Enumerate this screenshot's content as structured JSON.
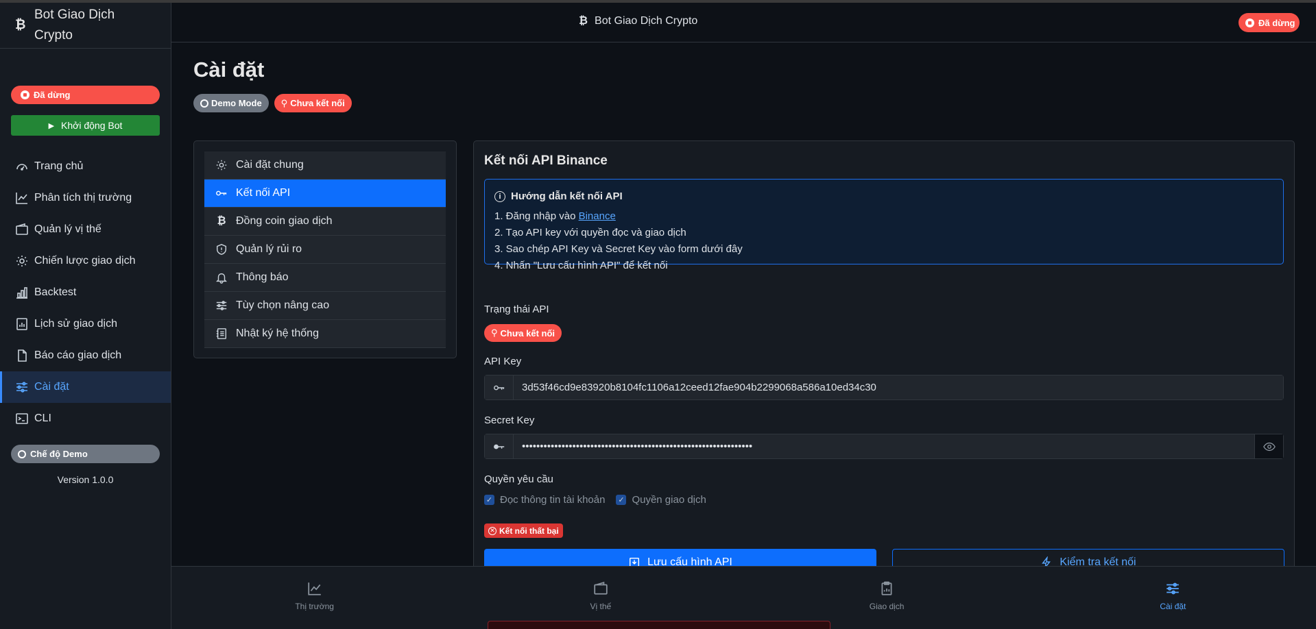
{
  "app": {
    "coin_symbol": "₿",
    "name": "Bot Giao Dịch Crypto"
  },
  "sidebar": {
    "status_label": "Đã dừng",
    "start_button": "Khởi động Bot",
    "items": [
      {
        "label": "Trang chủ",
        "icon": "dashboard-icon"
      },
      {
        "label": "Phân tích thị trường",
        "icon": "chart-line-icon"
      },
      {
        "label": "Quản lý vị thế",
        "icon": "wallet-icon"
      },
      {
        "label": "Chiến lược giao dịch",
        "icon": "gear-icon"
      },
      {
        "label": "Backtest",
        "icon": "bar-chart-icon"
      },
      {
        "label": "Lịch sử giao dịch",
        "icon": "history-chart-icon"
      },
      {
        "label": "Báo cáo giao dịch",
        "icon": "file-report-icon"
      },
      {
        "label": "Cài đặt",
        "icon": "sliders-icon",
        "active": true
      },
      {
        "label": "CLI",
        "icon": "terminal-icon"
      }
    ],
    "demo_label": "Chế độ Demo",
    "version": "Version 1.0.0"
  },
  "header": {
    "title": "Bot Giao Dịch Crypto",
    "status_label": "Đã dừng"
  },
  "page": {
    "title": "Cài đặt",
    "badges": {
      "demo": "Demo Mode",
      "connection": "Chưa kết nối"
    }
  },
  "settings_menu": [
    {
      "label": "Cài đặt chung",
      "icon": "gear-icon"
    },
    {
      "label": "Kết nối API",
      "icon": "key-icon",
      "active": true
    },
    {
      "label": "Đồng coin giao dịch",
      "icon": "bitcoin-icon"
    },
    {
      "label": "Quản lý rủi ro",
      "icon": "shield-icon"
    },
    {
      "label": "Thông báo",
      "icon": "bell-icon"
    },
    {
      "label": "Tùy chọn nâng cao",
      "icon": "sliders-icon"
    },
    {
      "label": "Nhật ký hệ thống",
      "icon": "journal-icon"
    }
  ],
  "api_panel": {
    "title": "Kết nối API Binance",
    "guide": {
      "heading": "Hướng dẫn kết nối API",
      "step1_prefix": "1. Đăng nhập vào ",
      "step1_link": "Binance",
      "step2": "2. Tạo API key với quyền đọc và giao dịch",
      "step3": "3. Sao chép API Key và Secret Key vào form dưới đây",
      "step4": "4. Nhấn \"Lưu cấu hình API\" để kết nối"
    },
    "status_label": "Trạng thái API",
    "status_value": "Chưa kết nối",
    "api_key_label": "API Key",
    "api_key_value": "3d53f46cd9e83920b8104fc1106a12ceed12fae904b2299068a586a10ed34c30",
    "secret_key_label": "Secret Key",
    "secret_key_value": "••••••••••••••••••••••••••••••••••••••••••••••••••••••••••••••••",
    "permissions_label": "Quyền yêu cầu",
    "permission_read": "Đọc thông tin tài khoản",
    "permission_trade": "Quyền giao dịch",
    "result_badge": "Kết nối thất bại",
    "save_button": "Lưu cấu hình API",
    "test_button": "Kiểm tra kết nối"
  },
  "bottom_nav": [
    {
      "label": "Thị trường",
      "icon": "chart-line-icon"
    },
    {
      "label": "Vị thế",
      "icon": "wallet-icon"
    },
    {
      "label": "Giao dịch",
      "icon": "clipboard-icon"
    },
    {
      "label": "Cài đặt",
      "icon": "sliders-icon",
      "active": true
    }
  ],
  "colors": {
    "accent": "#0d6efd",
    "danger": "#f85149",
    "success": "#238636",
    "background": "#0d1117",
    "panel": "#161b22"
  }
}
